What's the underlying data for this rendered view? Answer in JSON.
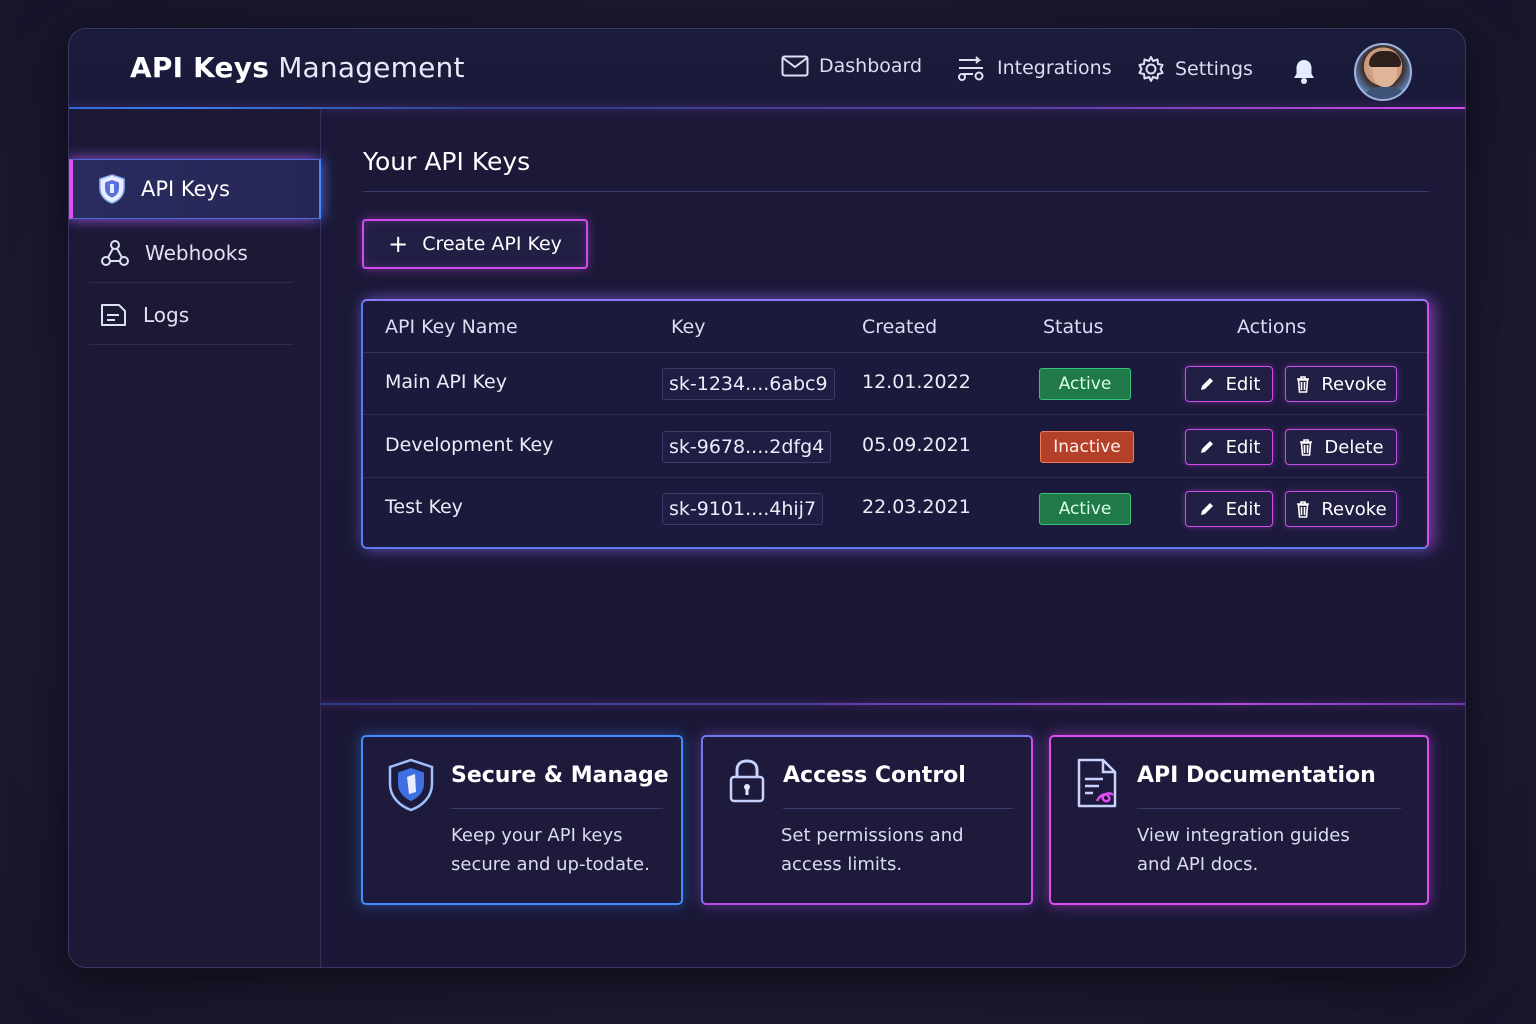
{
  "header": {
    "title_bold": "API Keys",
    "title_light": "Management",
    "nav": [
      {
        "label": "Dashboard",
        "icon": "mail-icon"
      },
      {
        "label": "Integrations",
        "icon": "integrations-icon"
      },
      {
        "label": "Settings",
        "icon": "gear-icon"
      }
    ],
    "notifications_icon": "bell-icon",
    "avatar_icon": "user-avatar"
  },
  "sidebar": {
    "items": [
      {
        "label": "API Keys",
        "icon": "shield-icon",
        "active": true
      },
      {
        "label": "Webhooks",
        "icon": "webhook-icon",
        "active": false
      },
      {
        "label": "Logs",
        "icon": "logs-icon",
        "active": false
      }
    ]
  },
  "main": {
    "title": "Your API Keys",
    "create_button": "Create API Key",
    "create_button_icon": "plus-icon",
    "table": {
      "columns": [
        "API Key Name",
        "Key",
        "Created",
        "Status",
        "Actions"
      ],
      "rows": [
        {
          "name": "Main API Key",
          "key": "sk-1234....6abc9",
          "created": "12.01.2022",
          "status": "Active",
          "actions": [
            "Edit",
            "Revoke"
          ]
        },
        {
          "name": "Development Key",
          "key": "sk-9678....2dfg4",
          "created": "05.09.2021",
          "status": "Inactive",
          "actions": [
            "Edit",
            "Delete"
          ]
        },
        {
          "name": "Test Key",
          "key": "sk-9101....4hij7",
          "created": "22.03.2021",
          "status": "Active",
          "actions": [
            "Edit",
            "Revoke"
          ]
        }
      ]
    }
  },
  "cards": [
    {
      "title": "Secure & Manage",
      "text": "Keep your API keys secure and up-todate.",
      "icon": "shield-icon"
    },
    {
      "title": "Access Control",
      "text": "Set permissions and access limits.",
      "icon": "lock-icon"
    },
    {
      "title": "API Documentation",
      "text": "View integration guides and API docs.",
      "icon": "document-icon"
    }
  ],
  "colors": {
    "accent_pink": "#d94bf0",
    "accent_blue": "#3f8cff",
    "status_active": "#1f7a47",
    "status_inactive": "#b5402a",
    "background": "#1a1836"
  }
}
